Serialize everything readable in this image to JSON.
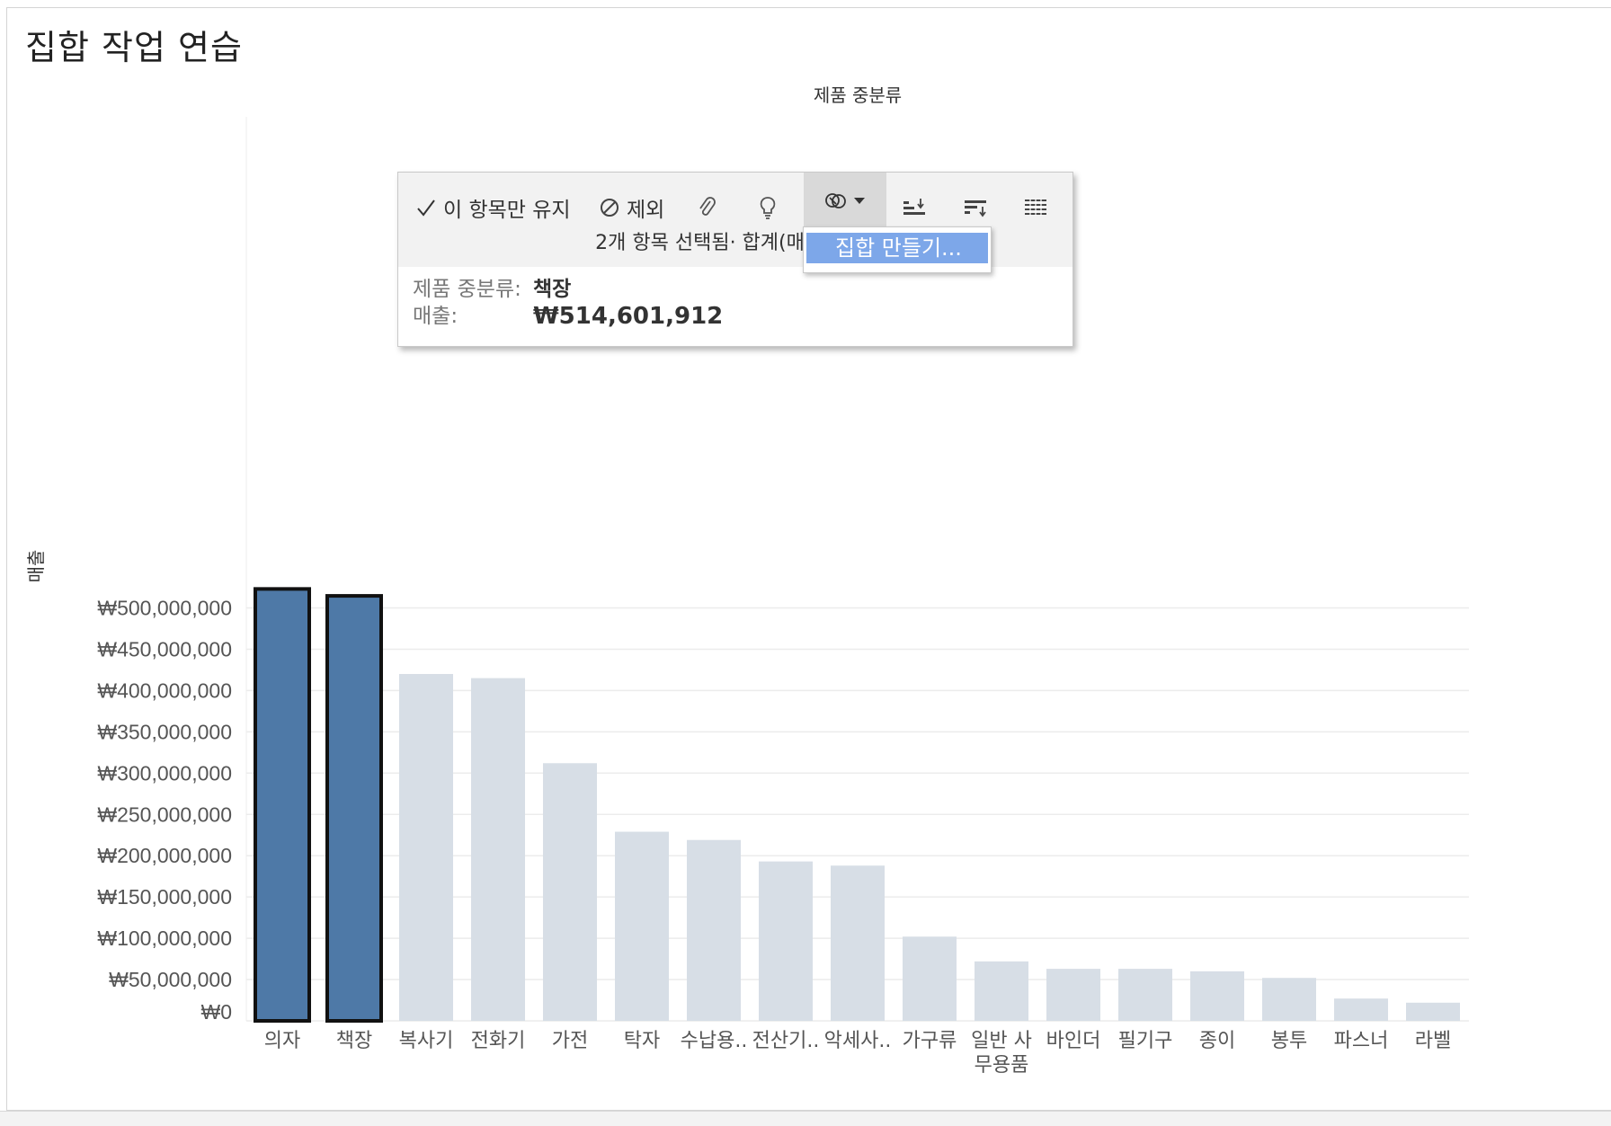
{
  "sheet_title": "집합 작업 연습",
  "colors": {
    "selected_bar": "#4e79a7",
    "selected_border": "#111111",
    "dimmed_bar": "#d7dee6",
    "gridline": "#ececec",
    "menu_highlight": "#7da7e9"
  },
  "chart_data": {
    "type": "bar",
    "title": "",
    "column_header": "제품 중분류",
    "xlabel": "",
    "ylabel": "매출",
    "ylim": [
      0,
      525000000
    ],
    "y_ticks": [
      0,
      50000000,
      100000000,
      150000000,
      200000000,
      250000000,
      300000000,
      350000000,
      400000000,
      450000000,
      500000000
    ],
    "y_tick_labels": [
      "₩0",
      "₩50,000,000",
      "₩100,000,000",
      "₩150,000,000",
      "₩200,000,000",
      "₩250,000,000",
      "₩300,000,000",
      "₩350,000,000",
      "₩400,000,000",
      "₩450,000,000",
      "₩500,000,000"
    ],
    "grid": true,
    "categories": [
      [
        "의자"
      ],
      [
        "책장"
      ],
      [
        "복사기"
      ],
      [
        "전화기"
      ],
      [
        "가전"
      ],
      [
        "탁자"
      ],
      [
        "수납용.."
      ],
      [
        "전산기.."
      ],
      [
        "악세사.."
      ],
      [
        "가구류"
      ],
      [
        "일반 사",
        "무용품"
      ],
      [
        "바인더"
      ],
      [
        "필기구"
      ],
      [
        "종이"
      ],
      [
        "봉투"
      ],
      [
        "파스너"
      ],
      [
        "라벨"
      ]
    ],
    "values": [
      523000000,
      514601912,
      420000000,
      415000000,
      312000000,
      229000000,
      219000000,
      193000000,
      188000000,
      102000000,
      72000000,
      63000000,
      63000000,
      60000000,
      52000000,
      27000000,
      22000000
    ],
    "selected": [
      true,
      true,
      false,
      false,
      false,
      false,
      false,
      false,
      false,
      false,
      false,
      false,
      false,
      false,
      false,
      false,
      false
    ]
  },
  "tooltip": {
    "toolbar": {
      "keep_only": "이 항목만 유지",
      "exclude": "제외",
      "group_icon": "paperclip-icon",
      "viz_icon": "lightbulb-icon",
      "sets_icon": "linked-circles-icon",
      "sort_asc_icon": "sort-ascending-icon",
      "sort_desc_icon": "sort-descending-icon",
      "view_data_icon": "view-data-icon"
    },
    "summary": "2개 항목 선택됨· 합계(매출): ₩1",
    "field_label": "제품 중분류:",
    "field_value": "책장",
    "measure_label": "매출:",
    "measure_value": "₩514,601,912"
  },
  "dropdown": {
    "items": [
      "집합 만들기..."
    ]
  }
}
